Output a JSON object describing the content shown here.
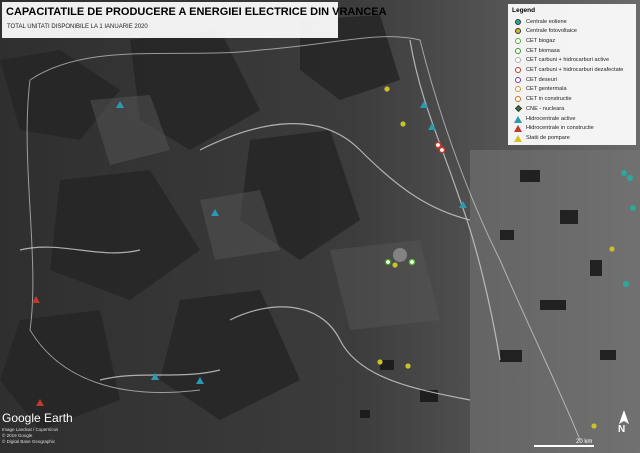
{
  "map": {
    "title": "CAPACITATILE DE PRODUCERE A ENERGIEI ELECTRICE DIN VRANCEA",
    "subtitle": "TOTAL UNITATI DISPONIBILE LA 1 IANUARIE 2020",
    "basemap_logo": "Google Earth",
    "credits": [
      "Image Landsat / Copernicus",
      "© 2019 Google",
      "© Digital Base Geographic"
    ],
    "scale_label": "20 km",
    "north_label": "N"
  },
  "legend": {
    "title": "Legend",
    "items": [
      {
        "label": "Centrale eoliene",
        "symbol": "dot",
        "color": "#2aa89a"
      },
      {
        "label": "Centrale fotovoltaice",
        "symbol": "dot",
        "color": "#c9c02a"
      },
      {
        "label": "CET biogaz",
        "symbol": "ring",
        "color": "#55b033"
      },
      {
        "label": "CET biomasa",
        "symbol": "ring",
        "color": "#3a9a2a"
      },
      {
        "label": "CET carbuni + hidrocarburi active",
        "symbol": "ring",
        "color": "#b0b0b0"
      },
      {
        "label": "CET carbuni + hidrocarburi dezafectate",
        "symbol": "ring",
        "color": "#c0392b"
      },
      {
        "label": "CET deseuri",
        "symbol": "ring",
        "color": "#7a3b9a"
      },
      {
        "label": "CET geotermala",
        "symbol": "ring",
        "color": "#d89a2a"
      },
      {
        "label": "CET in constructie",
        "symbol": "ring",
        "color": "#c9701a"
      },
      {
        "label": "CNE - nucleara",
        "symbol": "diamond",
        "color": "#2e7d32"
      },
      {
        "label": "Hidrocentrale active",
        "symbol": "triangle",
        "color": "#2a9ab0"
      },
      {
        "label": "Hidrocentrale in constructie",
        "symbol": "triangle",
        "color": "#c0392b"
      },
      {
        "label": "Statii de pompare",
        "symbol": "triangle",
        "color": "#d4c02a"
      }
    ]
  },
  "markers": [
    {
      "type": "hydro_active",
      "color": "#2a9ab0"
    },
    {
      "type": "hydro_active",
      "color": "#2a9ab0"
    },
    {
      "type": "hydro_active",
      "color": "#2a9ab0"
    },
    {
      "type": "hydro_active",
      "color": "#2a9ab0"
    },
    {
      "type": "hydro_active",
      "color": "#2a9ab0"
    },
    {
      "type": "hydro_active",
      "color": "#2a9ab0"
    },
    {
      "type": "hydro_active",
      "color": "#2a9ab0"
    },
    {
      "type": "hydro_construction",
      "color": "#c0392b"
    },
    {
      "type": "hydro_construction",
      "color": "#c0392b"
    },
    {
      "type": "hydro_construction",
      "color": "#c0392b"
    },
    {
      "type": "solar",
      "color": "#c9c02a"
    },
    {
      "type": "solar",
      "color": "#c9c02a"
    },
    {
      "type": "solar",
      "color": "#c9c02a"
    },
    {
      "type": "solar",
      "color": "#c9c02a"
    },
    {
      "type": "solar",
      "color": "#c9c02a"
    },
    {
      "type": "solar",
      "color": "#c9c02a"
    },
    {
      "type": "solar",
      "color": "#c9c02a"
    },
    {
      "type": "wind",
      "color": "#2aa89a"
    },
    {
      "type": "wind",
      "color": "#2aa89a"
    },
    {
      "type": "wind",
      "color": "#2aa89a"
    },
    {
      "type": "wind",
      "color": "#2aa89a"
    },
    {
      "type": "biogas",
      "color": "#55b033"
    },
    {
      "type": "biomass",
      "color": "#3a9a2a"
    },
    {
      "type": "cet_decommissioned",
      "color": "#c0392b"
    },
    {
      "type": "cet_decommissioned",
      "color": "#c0392b"
    }
  ]
}
